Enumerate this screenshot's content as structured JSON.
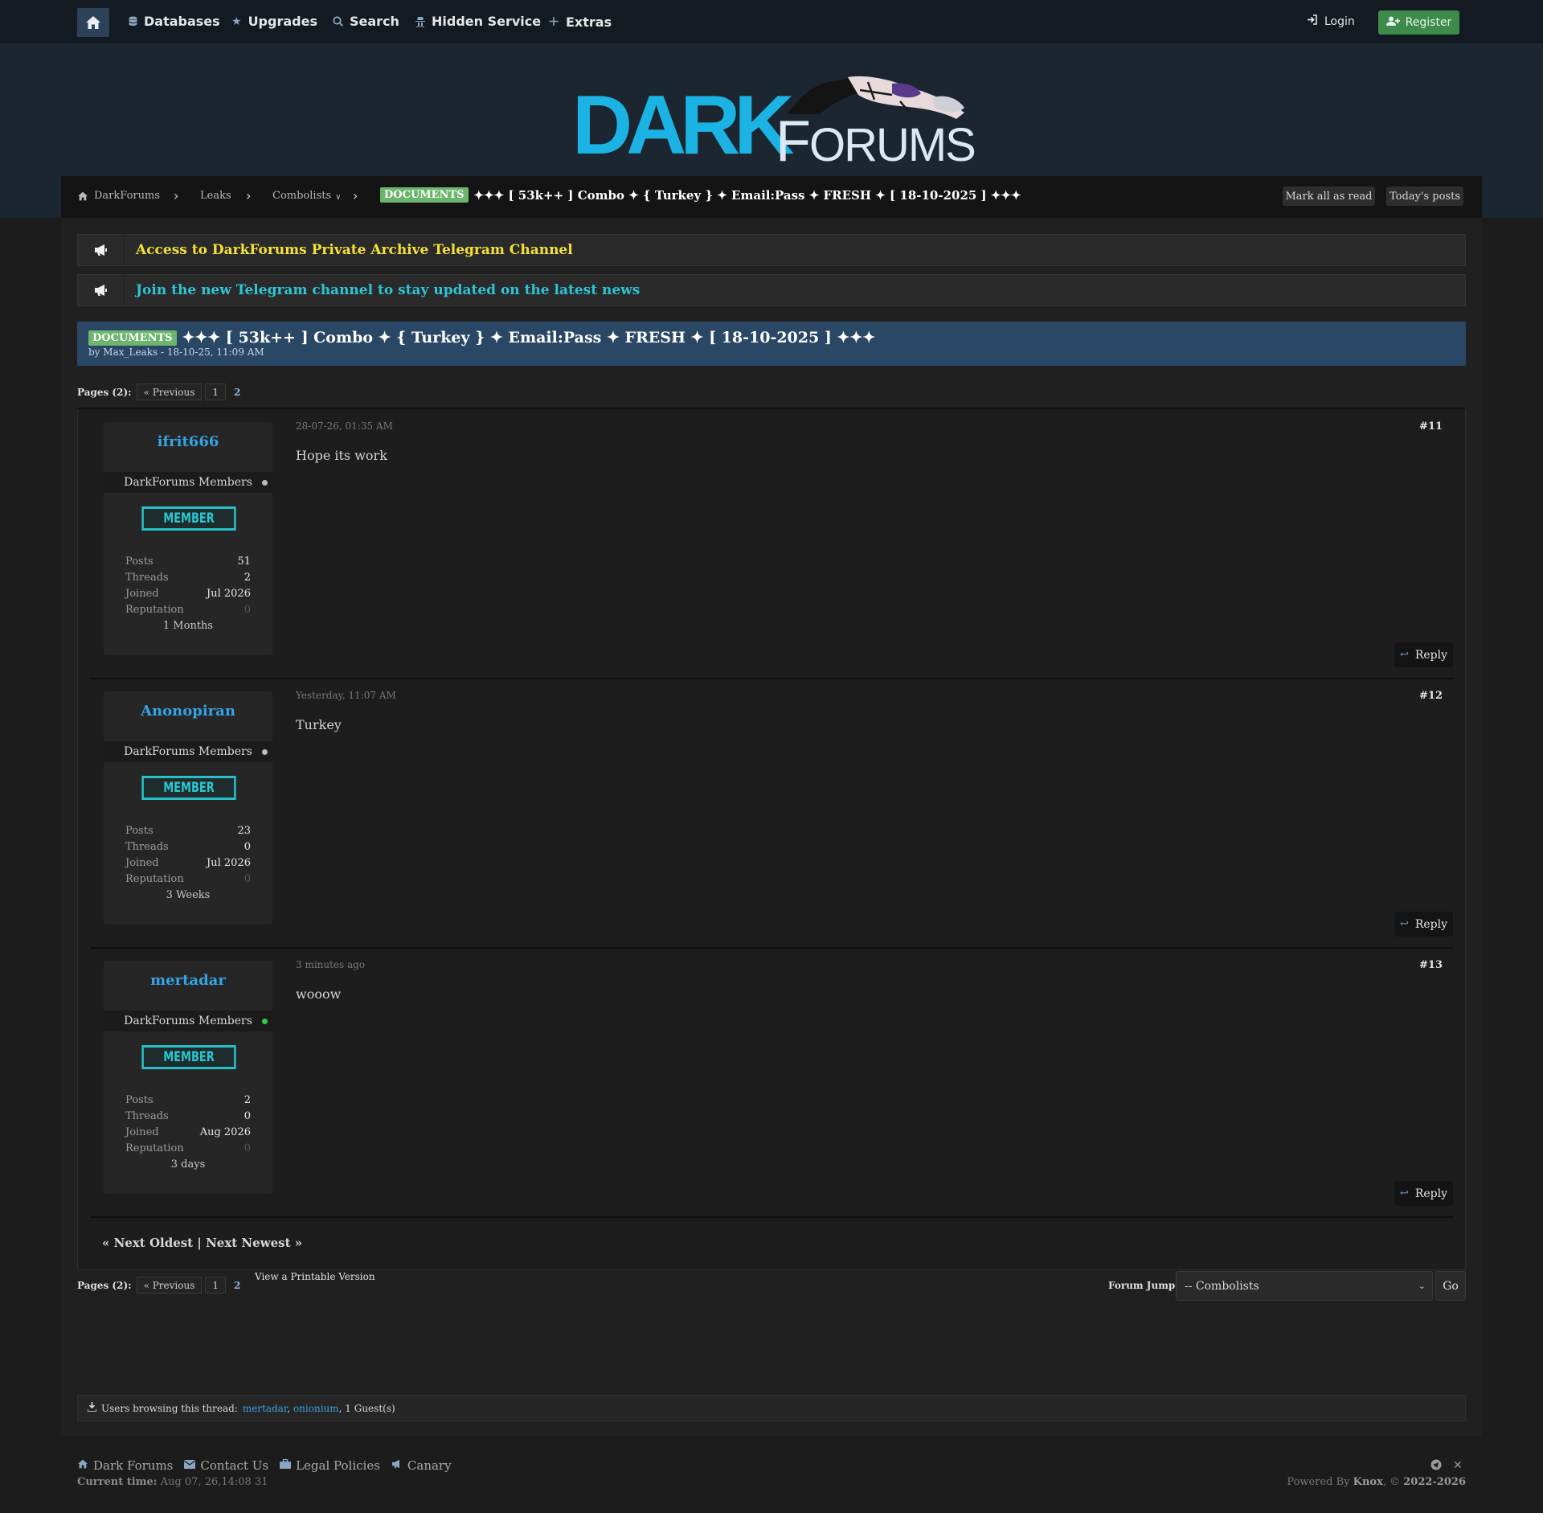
{
  "nav": {
    "items": [
      {
        "label": "Databases",
        "icon": "database-icon"
      },
      {
        "label": "Upgrades",
        "icon": "star-icon"
      },
      {
        "label": "Search",
        "icon": "search-icon"
      },
      {
        "label": "Hidden Service",
        "icon": "hidden-service-icon"
      },
      {
        "label": "Extras",
        "icon": "plus-icon"
      }
    ],
    "login": "Login",
    "register": "Register"
  },
  "logo": {
    "dark": "DARK",
    "forums_f": "F",
    "forums_rest": "ORUMS"
  },
  "breadcrumb": {
    "items": [
      "DarkForums",
      "Leaks",
      "Combolists"
    ],
    "dropdown_marker": "∨",
    "badge": "DOCUMENTS",
    "current": "✦✦✦ [ 53k++ ] Combo ✦ { Turkey } ✦ Email:Pass ✦ FRESH ✦ [ 18-10-2025 ] ✦✦✦",
    "mark_all_read": "Mark all as read",
    "todays_posts": "Today's posts"
  },
  "announcements": [
    {
      "text": "Access to DarkForums Private Archive Telegram Channel",
      "color": "#f3e13a"
    },
    {
      "text": "Join the new Telegram channel to stay updated on the latest news",
      "color": "#2ec4d8"
    }
  ],
  "thread": {
    "badge": "DOCUMENTS",
    "title": "✦✦✦ [ 53k++ ] Combo ✦ { Turkey } ✦ Email:Pass ✦ FRESH ✦ [ 18-10-2025 ] ✦✦✦",
    "byline": "by Max_Leaks - 18-10-25, 11:09 AM"
  },
  "pagination": {
    "label": "Pages (2):",
    "previous": "« Previous",
    "pages": [
      "1",
      "2"
    ]
  },
  "posts": [
    {
      "username": "ifrit666",
      "group": "DarkForums Members",
      "online": false,
      "rank": "MEMBER",
      "posts": "51",
      "threads": "2",
      "joined": "Jul 2026",
      "reputation": "0",
      "age": "1 Months",
      "date": "28-07-26, 01:35 AM",
      "number": "#11",
      "body": "Hope its work"
    },
    {
      "username": "Anonopiran",
      "group": "DarkForums Members",
      "online": false,
      "rank": "MEMBER",
      "posts": "23",
      "threads": "0",
      "joined": "Jul 2026",
      "reputation": "0",
      "age": "3 Weeks",
      "date": "Yesterday, 11:07 AM",
      "number": "#12",
      "body": "Turkey"
    },
    {
      "username": "mertadar",
      "group": "DarkForums Members",
      "online": true,
      "rank": "MEMBER",
      "posts": "2",
      "threads": "0",
      "joined": "Aug 2026",
      "reputation": "0",
      "age": "3 days",
      "date": "3 minutes ago",
      "number": "#13",
      "body": "wooow"
    }
  ],
  "stat_labels": {
    "posts": "Posts",
    "threads": "Threads",
    "joined": "Joined",
    "reputation": "Reputation"
  },
  "reply_label": "Reply",
  "thread_nav": {
    "prev": "« Next Oldest",
    "divider": "|",
    "next": "Next Newest »"
  },
  "printable": "View a Printable Version",
  "forum_jump": {
    "label": "Forum Jump:",
    "selected": "-- Combolists",
    "go": "Go"
  },
  "browsing": {
    "label": "Users browsing this thread:",
    "users": [
      "mertadar",
      "onionium"
    ],
    "guests": "1 Guest(s)"
  },
  "footer": {
    "links": [
      {
        "label": "Dark Forums",
        "icon": "home-icon"
      },
      {
        "label": "Contact Us",
        "icon": "envelope-icon"
      },
      {
        "label": "Legal Policies",
        "icon": "briefcase-icon"
      },
      {
        "label": "Canary",
        "icon": "bullhorn-icon"
      }
    ],
    "current_time_label": "Current time:",
    "current_time": "Aug 07, 26,14:08 31",
    "powered_by": "Powered By",
    "powered_name": "Knox",
    "copyright": "2022-2026"
  },
  "colors": {
    "accent_blue": "#35a4e6",
    "register_green": "#3d8b4a",
    "badge_green": "#6bb56d",
    "member_cyan": "#26c0c6",
    "thread_header": "#2a4866"
  }
}
